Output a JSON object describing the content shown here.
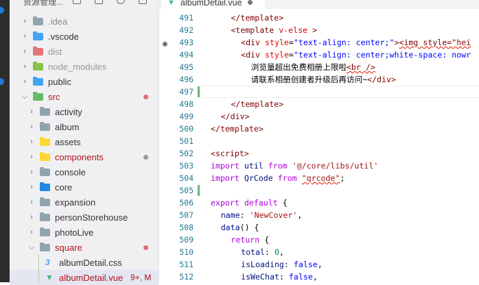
{
  "sidebar": {
    "title": "资源管理...",
    "items": [
      {
        "label": ".idea",
        "depth": 0,
        "open": false,
        "color": "#90a4ae",
        "text": "#888"
      },
      {
        "label": ".vscode",
        "depth": 0,
        "open": false,
        "color": "#42a5f5",
        "text": "#333"
      },
      {
        "label": "dist",
        "depth": 0,
        "open": false,
        "color": "#e57373",
        "text": "#999"
      },
      {
        "label": "node_modules",
        "depth": 0,
        "open": false,
        "color": "#8bc34a",
        "text": "#999"
      },
      {
        "label": "public",
        "depth": 0,
        "open": false,
        "color": "#42a5f5",
        "text": "#333"
      },
      {
        "label": "src",
        "depth": 0,
        "open": true,
        "color": "#66bb6a",
        "text": "#b3121b",
        "dot": "#e06c75"
      },
      {
        "label": "activity",
        "depth": 1,
        "open": false,
        "color": "#90a4ae",
        "text": "#333"
      },
      {
        "label": "album",
        "depth": 1,
        "open": false,
        "color": "#90a4ae",
        "text": "#333"
      },
      {
        "label": "assets",
        "depth": 1,
        "open": false,
        "color": "#fdd835",
        "text": "#333"
      },
      {
        "label": "components",
        "depth": 1,
        "open": false,
        "color": "#fdd835",
        "text": "#b3121b",
        "dot": "#999"
      },
      {
        "label": "console",
        "depth": 1,
        "open": false,
        "color": "#90a4ae",
        "text": "#333"
      },
      {
        "label": "core",
        "depth": 1,
        "open": false,
        "color": "#1e88e5",
        "text": "#333"
      },
      {
        "label": "expansion",
        "depth": 1,
        "open": false,
        "color": "#90a4ae",
        "text": "#333"
      },
      {
        "label": "personStorehouse",
        "depth": 1,
        "open": false,
        "color": "#90a4ae",
        "text": "#333"
      },
      {
        "label": "photoLive",
        "depth": 1,
        "open": false,
        "color": "#90a4ae",
        "text": "#333"
      },
      {
        "label": "square",
        "depth": 1,
        "open": true,
        "color": "#90a4ae",
        "text": "#b3121b",
        "dot": "#e06c75"
      }
    ],
    "files": [
      {
        "label": "albumDetail.css",
        "icon": "css-file-icon",
        "text": "#333"
      },
      {
        "label": "albumDetail.vue",
        "icon": "vue-file-icon",
        "text": "#b3121b",
        "badge": "9+, M",
        "selected": true
      }
    ]
  },
  "tab": {
    "label": "albumDetail.vue"
  },
  "editor": {
    "lines": [
      {
        "n": "491",
        "indent": 4,
        "t": [
          [
            "</template>",
            "tag"
          ]
        ]
      },
      {
        "n": "492",
        "indent": 4,
        "t": [
          [
            "<template ",
            "tag"
          ],
          [
            "v-else",
            "attr"
          ],
          [
            " >",
            "tag"
          ]
        ]
      },
      {
        "n": "493",
        "indent": 6,
        "t": [
          [
            "<div ",
            "tag"
          ],
          [
            "style",
            "attr"
          ],
          [
            "=",
            "txt"
          ],
          [
            "\"text-align: center;\"",
            "val"
          ],
          [
            ">",
            "tag"
          ],
          [
            "<img style=\"hei",
            "sqtag"
          ]
        ]
      },
      {
        "n": "494",
        "indent": 6,
        "t": [
          [
            "<div ",
            "tag"
          ],
          [
            "style",
            "attr"
          ],
          [
            "=",
            "txt"
          ],
          [
            "\"text-align: center;white-space: nowr",
            "val"
          ]
        ]
      },
      {
        "n": "495",
        "indent": 8,
        "t": [
          [
            "浏览量超出免费相册上限啦",
            "txt"
          ],
          [
            "<br />",
            "sqtag"
          ]
        ]
      },
      {
        "n": "496",
        "indent": 8,
        "t": [
          [
            "请联系相册创建者升级后再访问~",
            "txt"
          ],
          [
            "</div>",
            "tag"
          ]
        ]
      },
      {
        "n": "497",
        "indent": 0,
        "t": []
      },
      {
        "n": "498",
        "indent": 4,
        "t": [
          [
            "</template>",
            "tag"
          ]
        ]
      },
      {
        "n": "499",
        "indent": 2,
        "t": [
          [
            "</div>",
            "tag"
          ]
        ]
      },
      {
        "n": "500",
        "indent": 0,
        "t": [
          [
            "</template>",
            "tag"
          ]
        ]
      },
      {
        "n": "501",
        "indent": 0,
        "t": []
      },
      {
        "n": "502",
        "indent": 0,
        "t": [
          [
            "<script>",
            "tag"
          ]
        ]
      },
      {
        "n": "503",
        "indent": 0,
        "t": [
          [
            "import",
            "kw"
          ],
          [
            " util ",
            "prop"
          ],
          [
            "from",
            "kw"
          ],
          [
            " ",
            "txt"
          ],
          [
            "'@/core/libs/util'",
            "str"
          ]
        ]
      },
      {
        "n": "504",
        "indent": 0,
        "t": [
          [
            "import",
            "kw"
          ],
          [
            " QrCode ",
            "prop"
          ],
          [
            "from",
            "kw"
          ],
          [
            " ",
            "txt"
          ],
          [
            "\"qrcode\"",
            "sqstr"
          ],
          [
            ";",
            "txt"
          ]
        ]
      },
      {
        "n": "505",
        "indent": 0,
        "t": []
      },
      {
        "n": "506",
        "indent": 0,
        "t": [
          [
            "export",
            "kw"
          ],
          [
            " ",
            "txt"
          ],
          [
            "default",
            "kw"
          ],
          [
            " {",
            "txt"
          ]
        ]
      },
      {
        "n": "507",
        "indent": 2,
        "t": [
          [
            "name",
            "prop"
          ],
          [
            ": ",
            "txt"
          ],
          [
            "'NewCover'",
            "str"
          ],
          [
            ",",
            "txt"
          ]
        ]
      },
      {
        "n": "508",
        "indent": 2,
        "t": [
          [
            "data",
            "prop"
          ],
          [
            "() {",
            "txt"
          ]
        ]
      },
      {
        "n": "509",
        "indent": 4,
        "t": [
          [
            "return",
            "kw"
          ],
          [
            " {",
            "txt"
          ]
        ]
      },
      {
        "n": "510",
        "indent": 6,
        "t": [
          [
            "total",
            "prop"
          ],
          [
            ": ",
            "txt"
          ],
          [
            "0",
            "num"
          ],
          [
            ",",
            "txt"
          ]
        ]
      },
      {
        "n": "511",
        "indent": 6,
        "t": [
          [
            "isLoading",
            "prop"
          ],
          [
            ": ",
            "txt"
          ],
          [
            "false",
            "lit"
          ],
          [
            ",",
            "txt"
          ]
        ]
      },
      {
        "n": "512",
        "indent": 6,
        "t": [
          [
            "isWeChat",
            "prop"
          ],
          [
            ": ",
            "txt"
          ],
          [
            "false",
            "lit"
          ],
          [
            ",",
            "txt"
          ]
        ]
      }
    ]
  }
}
